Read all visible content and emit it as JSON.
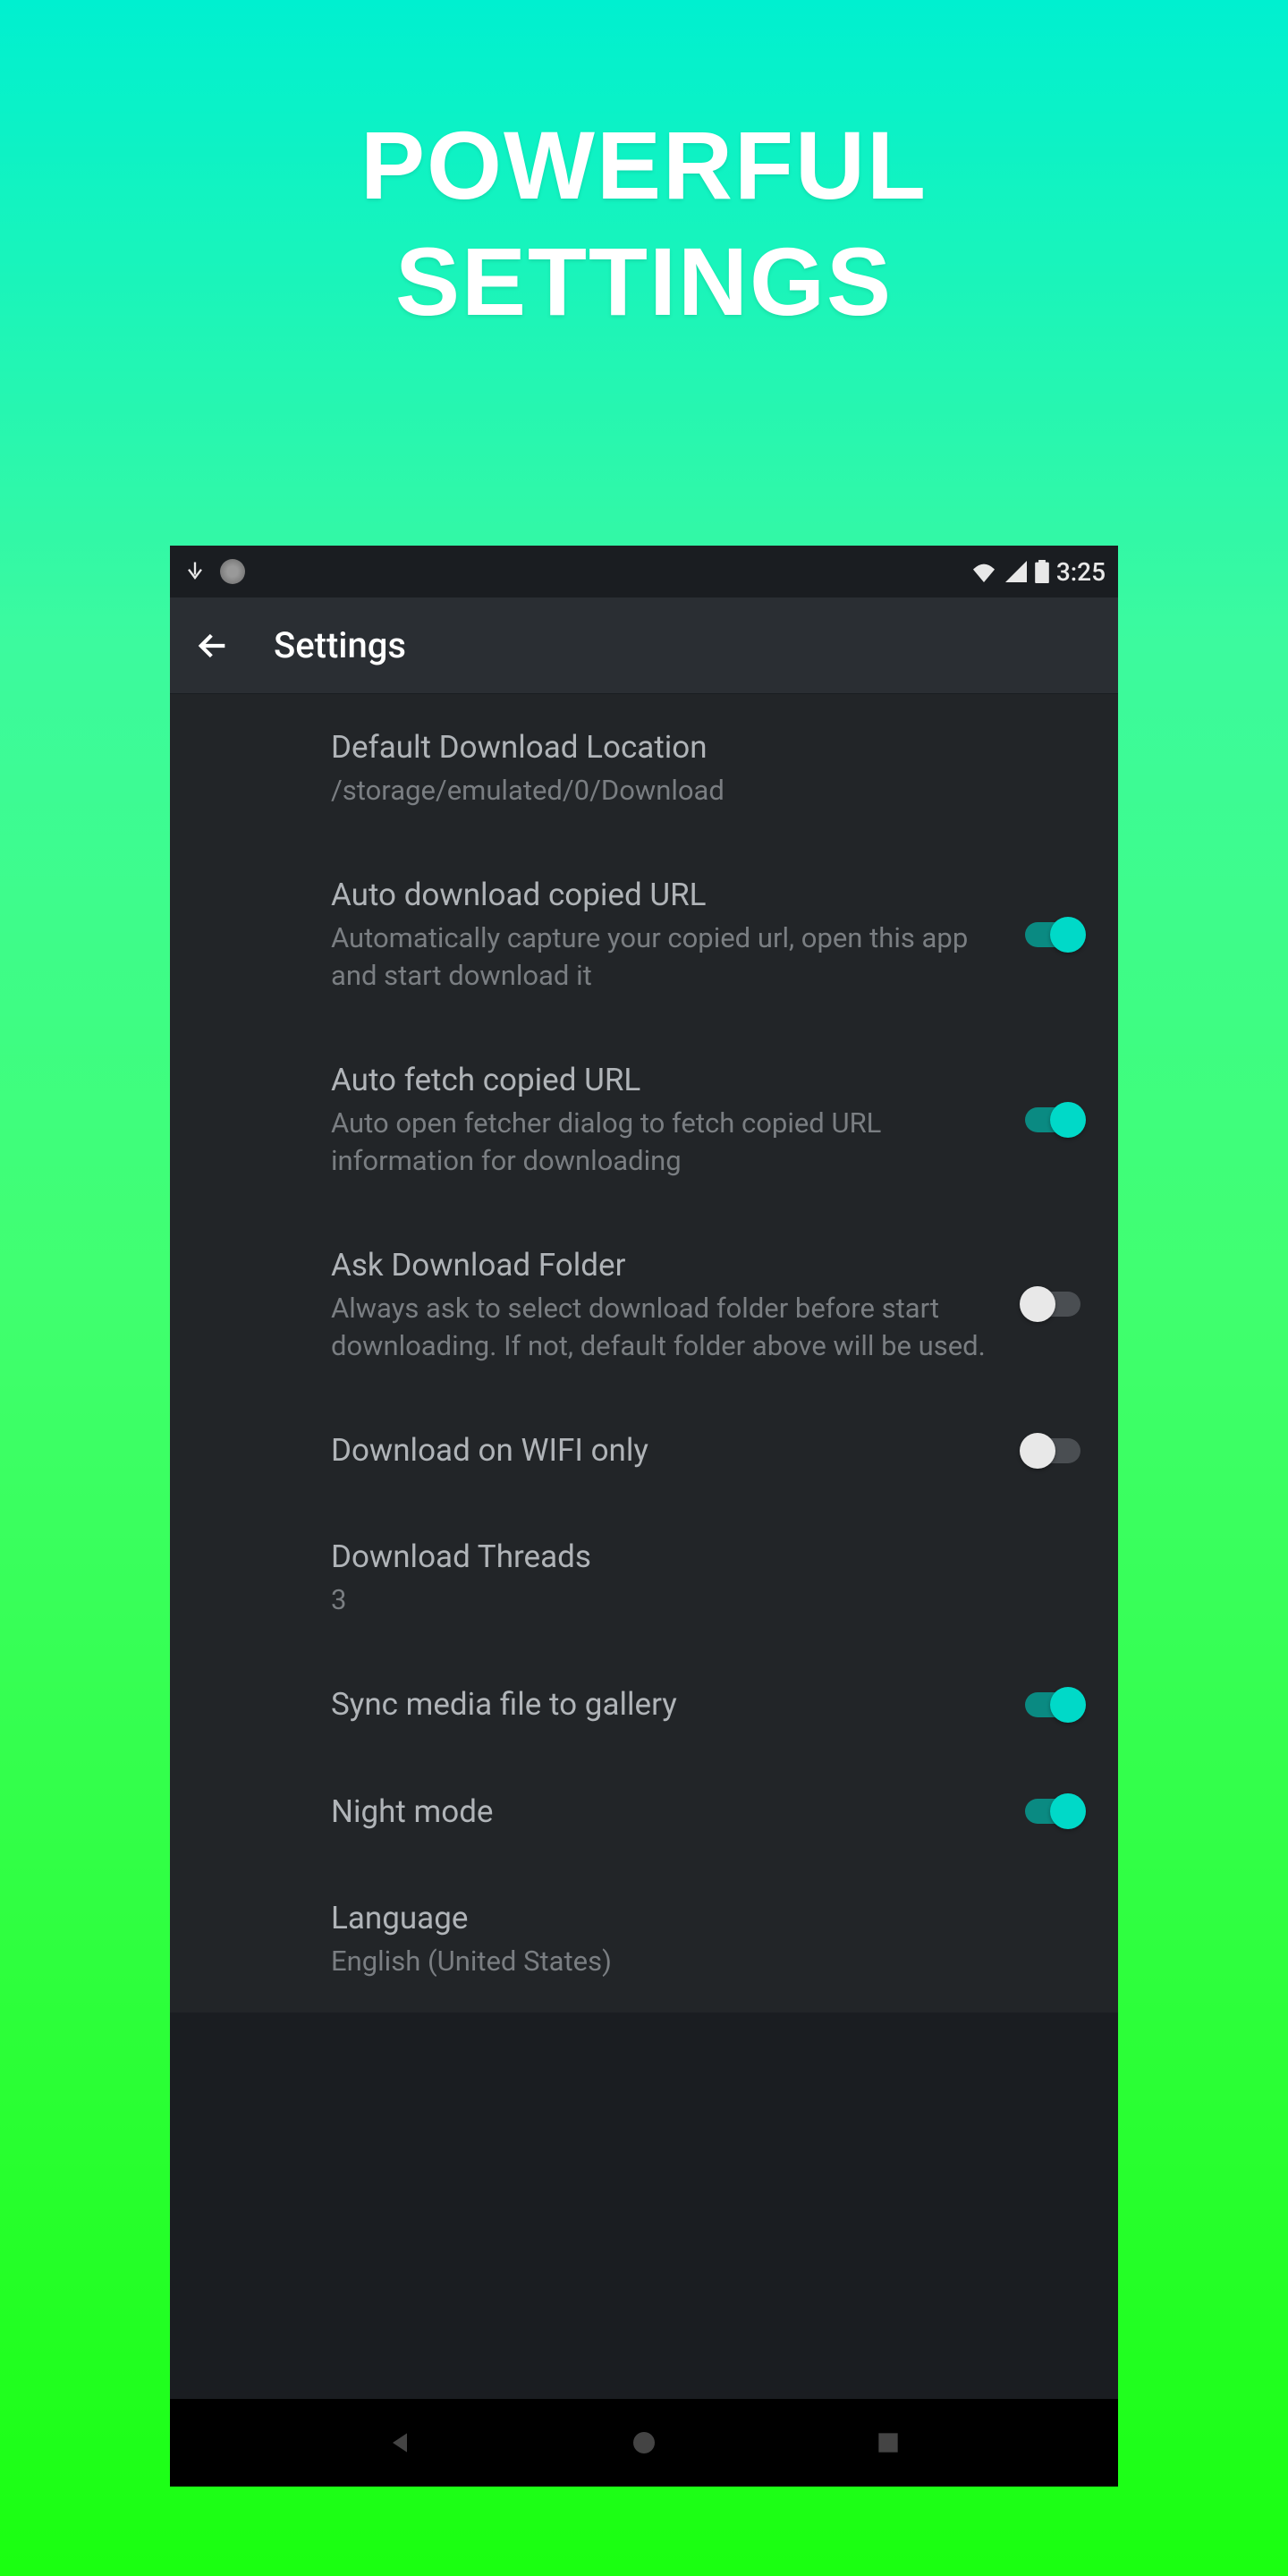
{
  "promo": {
    "line1": "POWERFUL",
    "line2": "SETTINGS"
  },
  "status_bar": {
    "time": "3:25"
  },
  "app_bar": {
    "title": "Settings"
  },
  "settings": {
    "default_location": {
      "title": "Default Download Location",
      "value": "/storage/emulated/0/Download"
    },
    "auto_download": {
      "title": "Auto download copied URL",
      "subtitle": "Automatically capture your copied url, open this app and start download it",
      "enabled": true
    },
    "auto_fetch": {
      "title": "Auto fetch copied URL",
      "subtitle": "Auto open fetcher dialog to fetch copied URL information for downloading",
      "enabled": true
    },
    "ask_folder": {
      "title": "Ask Download Folder",
      "subtitle": "Always ask to select download folder before start downloading. If not, default folder above will be used.",
      "enabled": false
    },
    "wifi_only": {
      "title": "Download on WIFI only",
      "enabled": false
    },
    "threads": {
      "title": "Download Threads",
      "value": "3"
    },
    "sync_gallery": {
      "title": "Sync media file to gallery",
      "enabled": true
    },
    "night_mode": {
      "title": "Night mode",
      "enabled": true
    },
    "language": {
      "title": "Language",
      "value": "English (United States)"
    }
  }
}
